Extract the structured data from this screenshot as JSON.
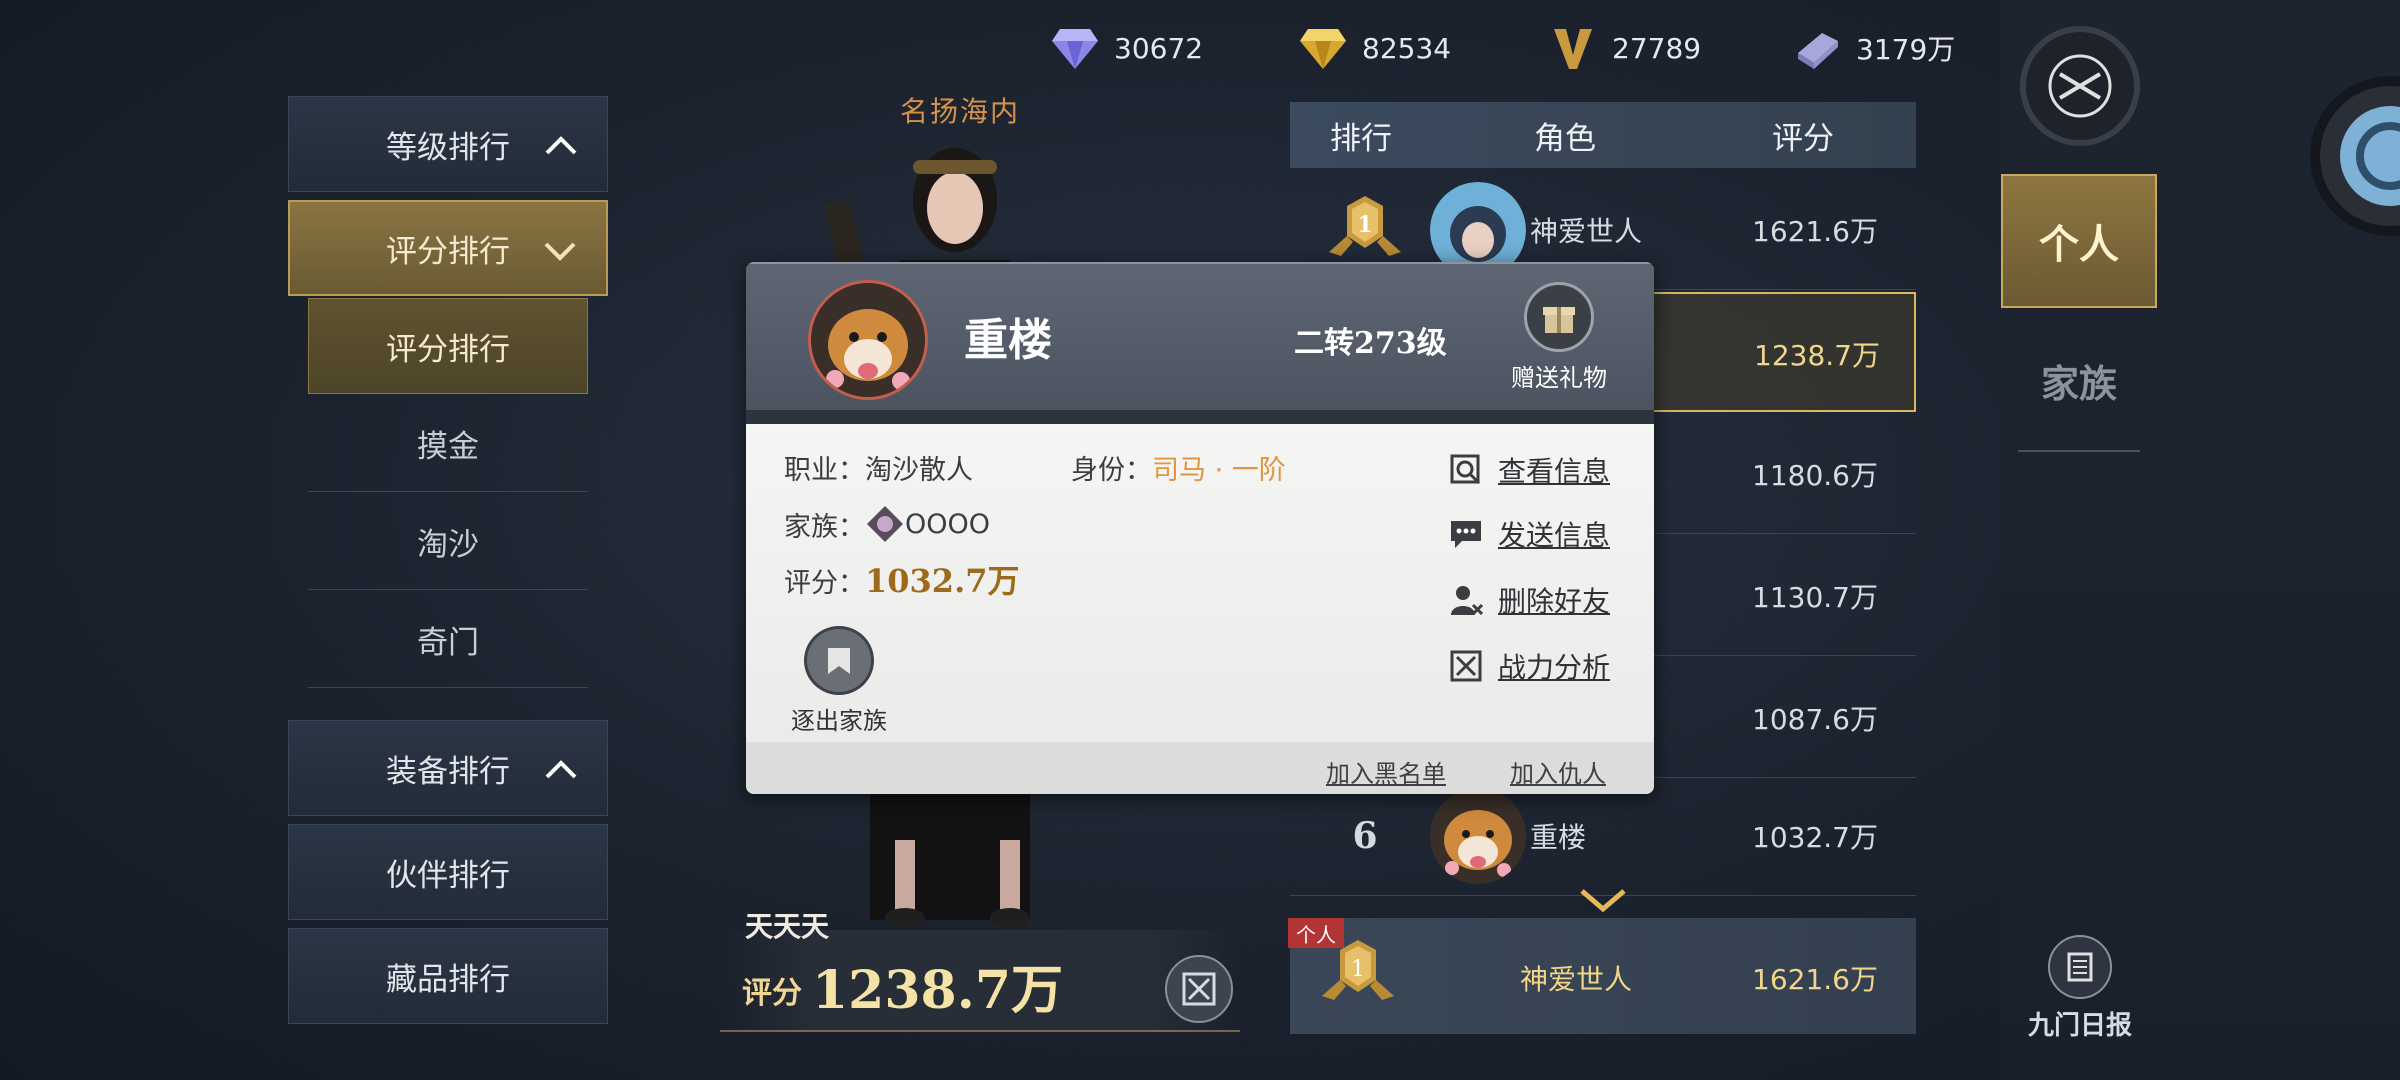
{
  "currencies": [
    {
      "icon": "blue-diamond-icon",
      "value": "30672"
    },
    {
      "icon": "gold-diamond-icon",
      "value": "82534"
    },
    {
      "icon": "v-coin-icon",
      "value": "27789"
    },
    {
      "icon": "silver-ingot-icon",
      "value": "3179万"
    }
  ],
  "menu": {
    "level_rank": "等级排行",
    "score_rank": "评分排行",
    "sub_items": [
      "评分排行",
      "摸金",
      "淘沙",
      "奇门"
    ],
    "equip_rank": "装备排行",
    "partner_rank": "伙伴排行",
    "collection_rank": "藏品排行"
  },
  "character": {
    "title": "名扬海内",
    "player_name": "天天天",
    "score_label": "评分",
    "score_value": "1238.7万"
  },
  "table": {
    "headers": [
      "排行",
      "角色",
      "评分"
    ],
    "rows": [
      {
        "rank": "1",
        "name": "神爱世人",
        "score": "1621.6万"
      },
      {
        "rank": "",
        "name": "",
        "score": "1238.7万"
      },
      {
        "rank": "",
        "name": "",
        "score": "1180.6万"
      },
      {
        "rank": "",
        "name": "",
        "score": "1130.7万"
      },
      {
        "rank": "",
        "name": "",
        "score": "1087.6万"
      },
      {
        "rank": "6",
        "name": "重楼",
        "score": "1032.7万"
      }
    ],
    "my_row": {
      "tag": "个人",
      "rank": "1",
      "name": "神爱世人",
      "score": "1621.6万"
    }
  },
  "right": {
    "tab_personal": "个人",
    "tab_family": "家族",
    "daily_report": "九门日报"
  },
  "popup": {
    "name": "重楼",
    "level": "二转273级",
    "gift_label": "赠送礼物",
    "job_label": "职业：",
    "job_value": "淘沙散人",
    "identity_label": "身份：",
    "identity_value": "司马 · 一阶",
    "family_label": "家族：",
    "family_value": "OOOO",
    "score_label": "评分：",
    "score_value": "1032.7万",
    "actions": [
      "查看信息",
      "发送信息",
      "删除好友",
      "战力分析"
    ],
    "kick_label": "逐出家族",
    "blacklist": "加入黑名单",
    "enemy": "加入仇人"
  },
  "colors": {
    "gold": "#d9b763",
    "orange": "#e0953f",
    "tag_red": "#b33434"
  }
}
